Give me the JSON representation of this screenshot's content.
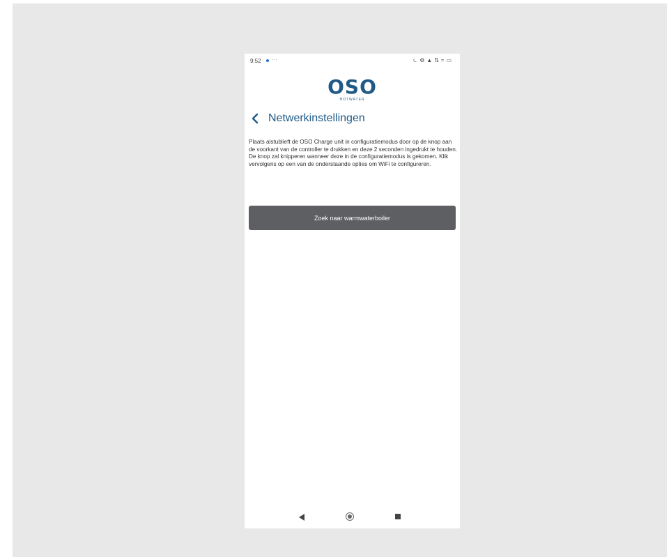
{
  "statusbar": {
    "time": "9:52",
    "more": "···",
    "icons": [
      "alarm-icon",
      "settings-icon",
      "signal-icon",
      "data-icon",
      "wifi-icon",
      "battery-icon"
    ],
    "icon_glyphs": [
      "⏾",
      "⚙",
      "▲",
      "⇅",
      "≈",
      "▭"
    ]
  },
  "logo": {
    "name": "OSO",
    "tagline": "HOTWATER"
  },
  "header": {
    "title": "Netwerkinstellingen"
  },
  "main": {
    "description": "Plaats alstublieft de OSO Charge unit in configuratiemodus door op de knop aan de voorkant van de controller te drukken en deze 2 seconden ingedrukt te houden. De knop zal knipperen wanneer deze in de configuratiemodus is gekomen. Klik vervolgens op een van de onderstaande opties om WiFi te configureren.",
    "search_button_label": "Zoek naar warmwaterboiler"
  },
  "colors": {
    "brand": "#1f5a86",
    "button": "#5d5f62",
    "background": "#e8e8e8"
  }
}
